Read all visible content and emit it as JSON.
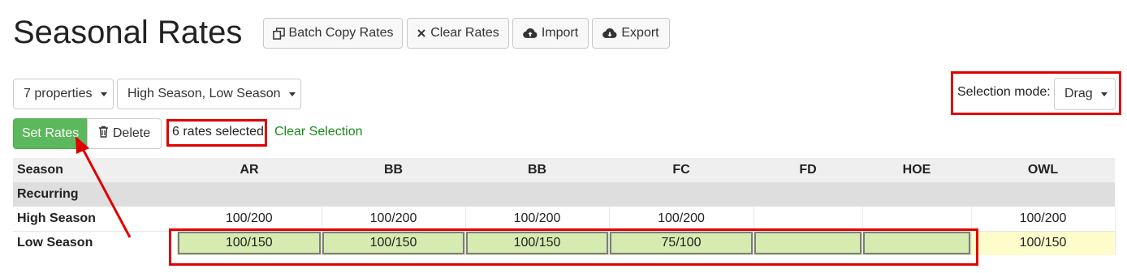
{
  "page": {
    "title": "Seasonal Rates"
  },
  "toolbar": {
    "batch_copy_label": "Batch Copy Rates",
    "clear_rates_label": "Clear Rates",
    "import_label": "Import",
    "export_label": "Export"
  },
  "filters": {
    "properties_value": "7 properties",
    "seasons_value": "High Season, Low Season"
  },
  "selection_mode": {
    "label": "Selection mode:",
    "value": "Drag"
  },
  "actions": {
    "set_rates_label": "Set Rates",
    "delete_label": "Delete",
    "selected_count_text": "6 rates selected",
    "clear_selection_label": "Clear Selection"
  },
  "table": {
    "columns": [
      "Season",
      "AR",
      "BB",
      "BB",
      "FC",
      "FD",
      "HOE",
      "OWL"
    ],
    "group_label": "Recurring",
    "rows": [
      {
        "label": "High Season",
        "cells": [
          "100/200",
          "100/200",
          "100/200",
          "100/200",
          "",
          "",
          "100/200"
        ]
      },
      {
        "label": "Low Season",
        "cells": [
          "100/150",
          "100/150",
          "100/150",
          "75/100",
          "",
          "",
          "100/150"
        ]
      }
    ]
  },
  "colors": {
    "set_rates_bg": "#5cb85c",
    "selected_cell_bg": "#d6ebb0",
    "unselected_low_cell_bg": "#fdfcca",
    "annotation_red": "#e00000",
    "clear_selection_link": "#1a8a1a"
  }
}
